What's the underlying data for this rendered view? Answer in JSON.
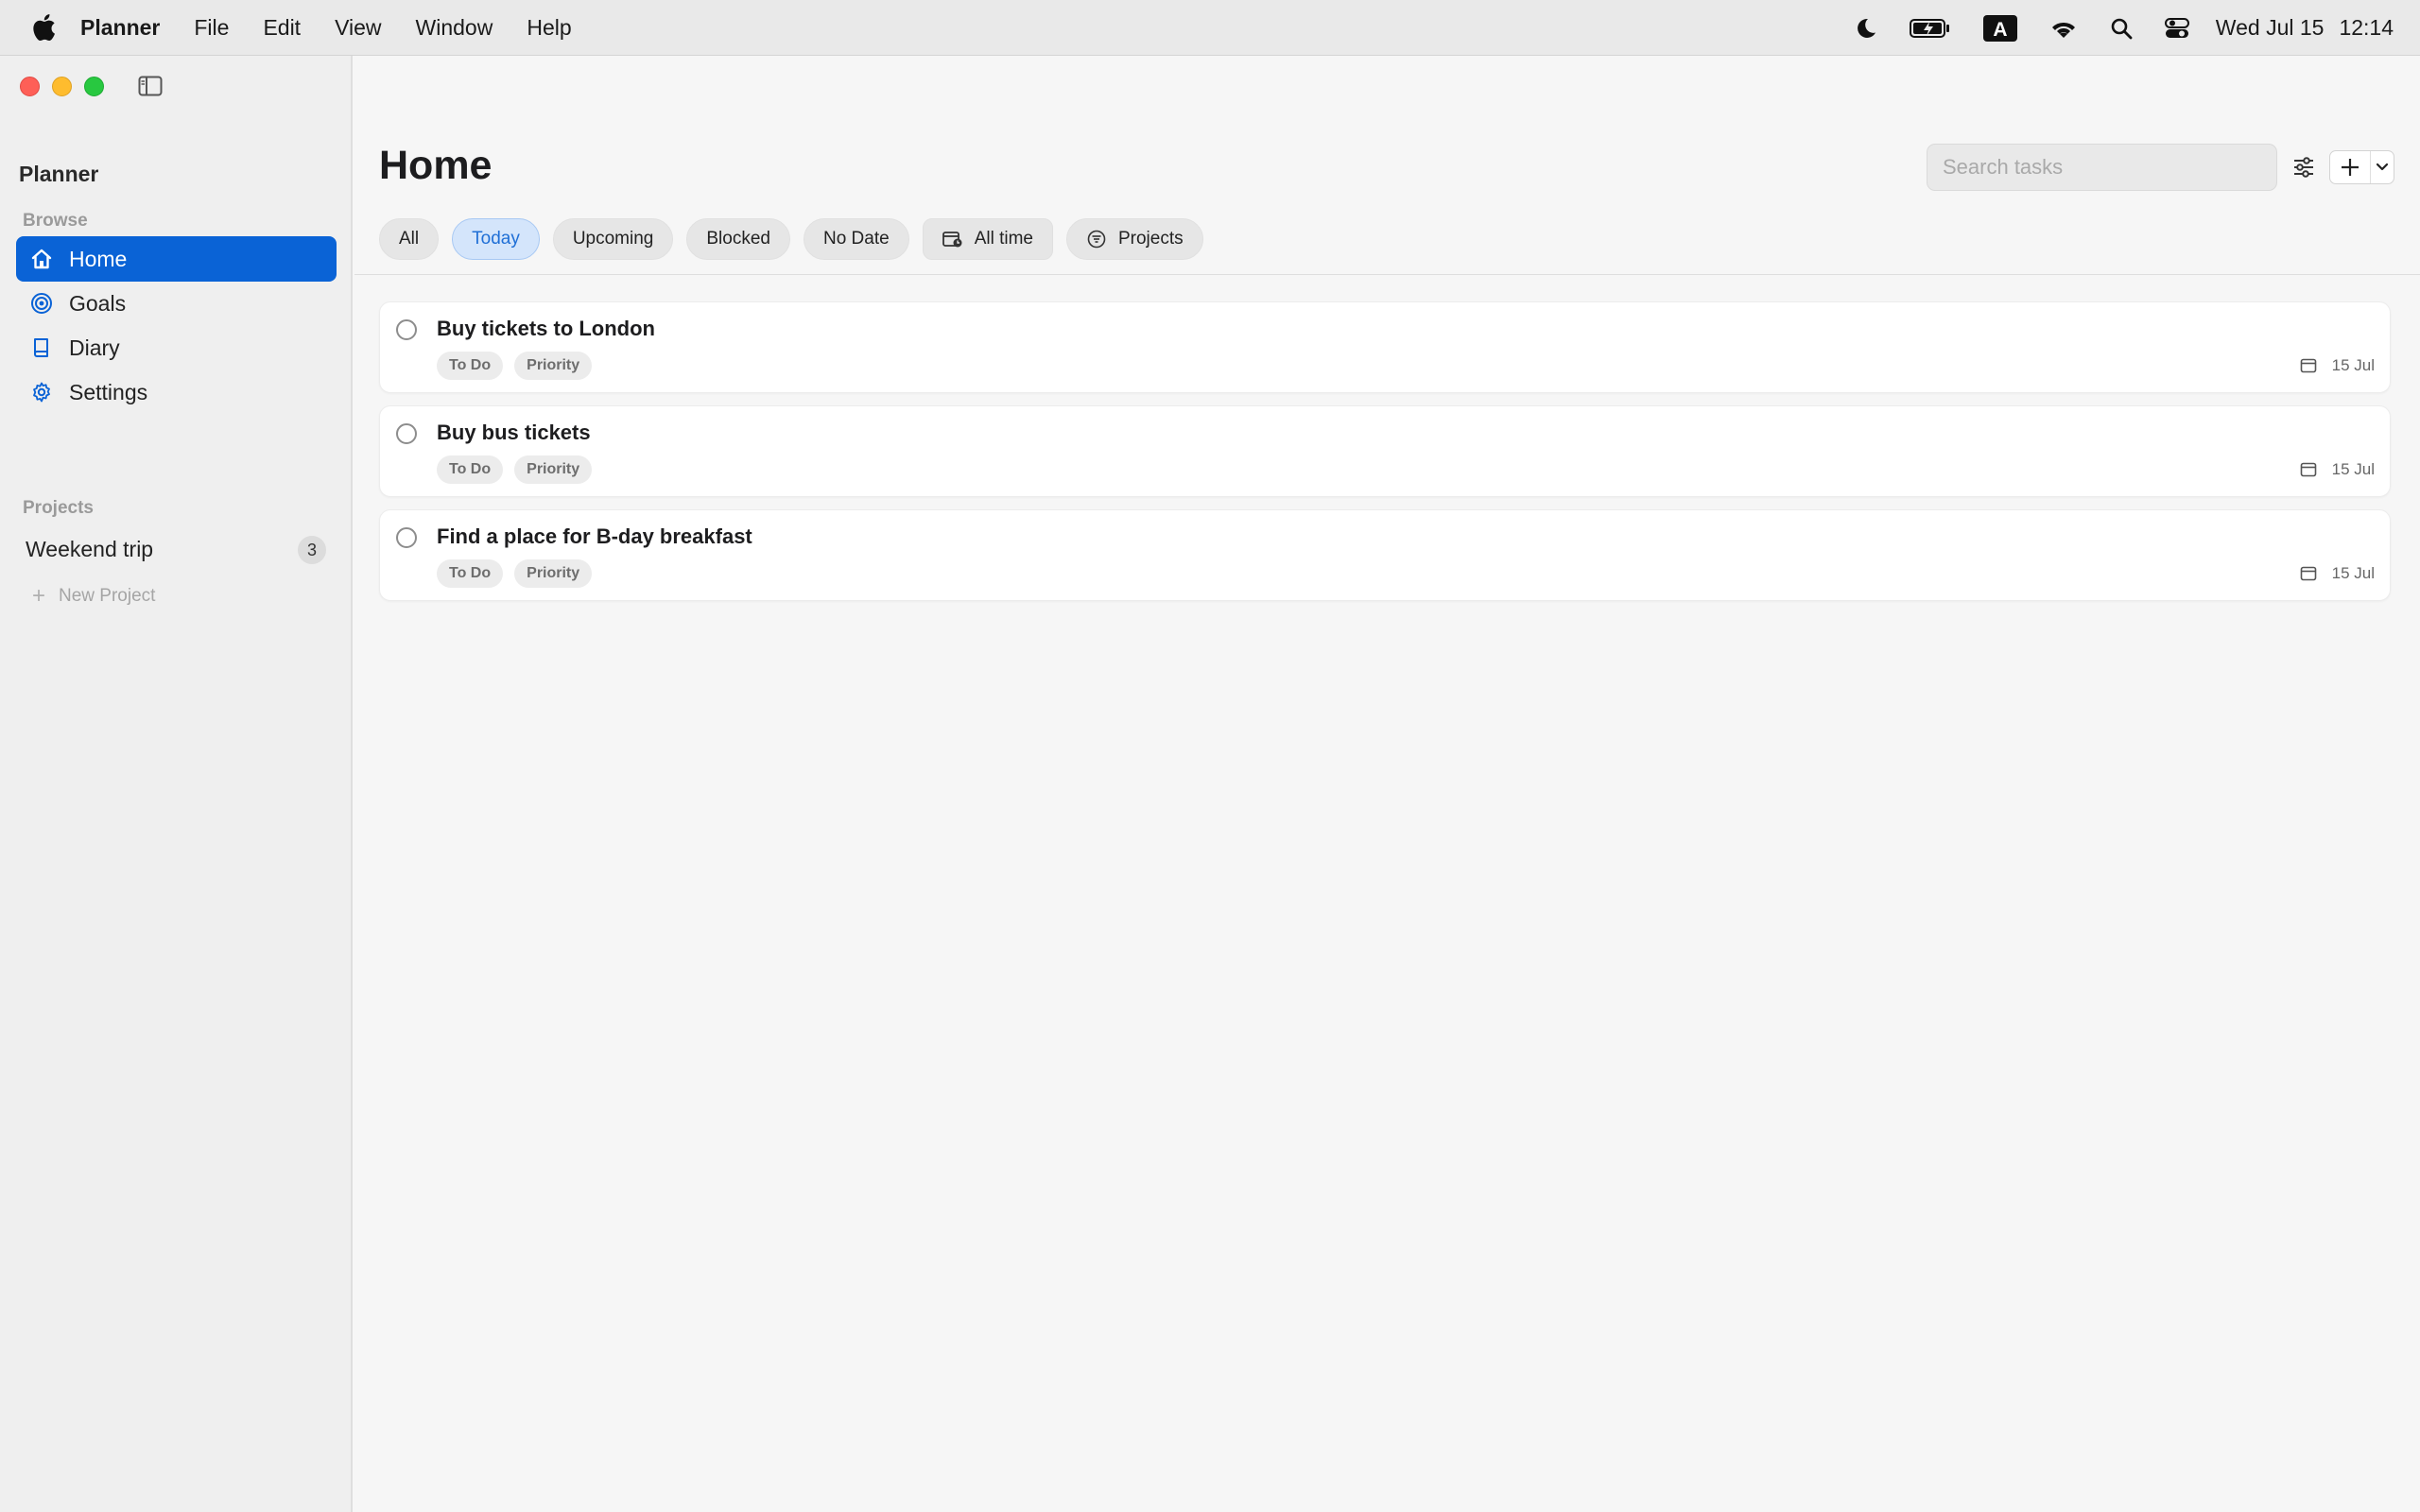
{
  "menubar": {
    "app": "Planner",
    "items": [
      "File",
      "Edit",
      "View",
      "Window",
      "Help"
    ],
    "input_indicator": "A",
    "day": "Wed Jul 15",
    "time": "12:14"
  },
  "sidebar": {
    "title": "Planner",
    "browse_label": "Browse",
    "nav": [
      {
        "label": "Home",
        "icon": "house-icon",
        "active": true
      },
      {
        "label": "Goals",
        "icon": "target-icon"
      },
      {
        "label": "Diary",
        "icon": "book-icon"
      },
      {
        "label": "Settings",
        "icon": "gear-icon"
      }
    ],
    "projects_label": "Projects",
    "projects": [
      {
        "label": "Weekend trip",
        "count": "3"
      }
    ],
    "new_project": "New Project"
  },
  "main": {
    "title": "Home",
    "search_placeholder": "Search tasks",
    "filters": [
      {
        "label": "All"
      },
      {
        "label": "Today",
        "active": true
      },
      {
        "label": "Upcoming"
      },
      {
        "label": "Blocked"
      },
      {
        "label": "No Date"
      },
      {
        "label": "All time",
        "icon": "calendar-clock-icon"
      },
      {
        "label": "Projects",
        "icon": "filter-circle-icon"
      }
    ],
    "tasks": [
      {
        "title": "Buy tickets to London",
        "status": "To Do",
        "priority": "Priority",
        "date": "15 Jul"
      },
      {
        "title": "Buy bus tickets",
        "status": "To Do",
        "priority": "Priority",
        "date": "15 Jul"
      },
      {
        "title": "Find a place for B-day breakfast",
        "status": "To Do",
        "priority": "Priority",
        "date": "15 Jul"
      }
    ]
  },
  "colors": {
    "accent": "#0a63d6",
    "active_chip_bg": "#d4e5fb",
    "active_chip_text": "#1f6fd6",
    "close": "#fe5f57",
    "minimize": "#febc2e",
    "zoom": "#28c840"
  }
}
